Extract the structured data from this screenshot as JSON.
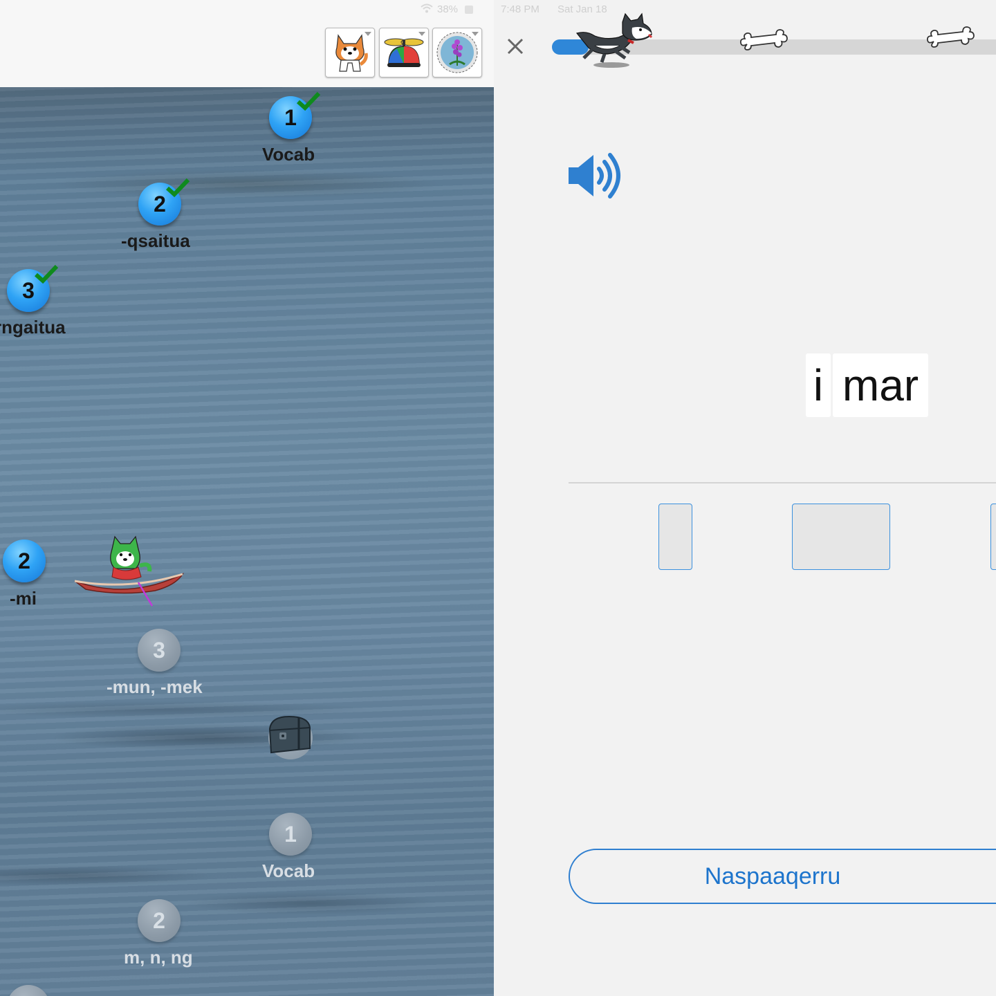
{
  "status_bar": {
    "time": "7:48 PM",
    "date": "Sat Jan 18",
    "battery": "38%"
  },
  "toolbar": {
    "avatars": [
      {
        "icon": "shiba-dog-icon"
      },
      {
        "icon": "propeller-hat-icon"
      },
      {
        "icon": "fireweed-badge-icon"
      }
    ]
  },
  "map": {
    "nodes": [
      {
        "number": "1",
        "label": "Vocab",
        "state": "completed"
      },
      {
        "number": "2",
        "label": "-qsaitua",
        "state": "completed"
      },
      {
        "number": "3",
        "label": "rngaitua",
        "state": "completed"
      },
      {
        "number": "2",
        "label": "-mi",
        "state": "completed"
      },
      {
        "number": "3",
        "label": "-mun, -mek",
        "state": "locked"
      },
      {
        "number": "1",
        "label": "Vocab",
        "state": "locked"
      },
      {
        "number": "2",
        "label": "m, n, ng",
        "state": "locked"
      }
    ],
    "chest": {
      "icon": "treasure-chest-icon",
      "state": "locked"
    },
    "player": {
      "icon": "husky-in-kayak-icon"
    }
  },
  "lesson": {
    "progress": 0.08,
    "milestones": [
      {
        "icon": "bone-icon"
      },
      {
        "icon": "bone-icon"
      }
    ],
    "audio": {
      "icon": "speaker-icon"
    },
    "answer_tiles": [
      "i",
      "mar"
    ],
    "choice_slots": 3,
    "submit_label": "Naspaaqerru"
  },
  "colors": {
    "accent": "#2f87d8",
    "completed_node": "#2fa3f5",
    "locked_node": "#8c9aa7",
    "check": "#0f8a1e",
    "water": "#6887a1"
  }
}
